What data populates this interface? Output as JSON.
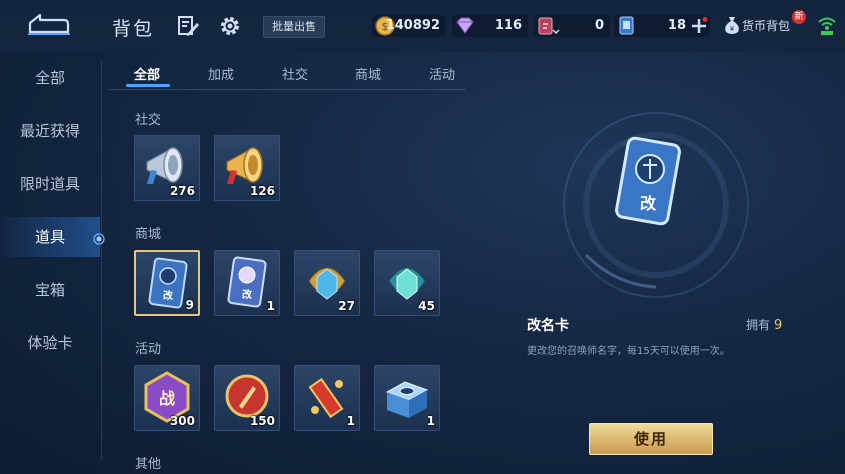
{
  "header": {
    "title": "背包",
    "bulk_sell_label": "批量出售",
    "currency_bag_label": "货币背包",
    "new_badge": "新"
  },
  "resources": [
    {
      "name": "gold-coin",
      "value": "140892"
    },
    {
      "name": "diamond",
      "value": "116"
    },
    {
      "name": "ticket",
      "value": "0"
    },
    {
      "name": "voucher",
      "value": "18"
    }
  ],
  "sidebar": {
    "items": [
      {
        "label": "全部"
      },
      {
        "label": "最近获得"
      },
      {
        "label": "限时道具"
      },
      {
        "label": "道具",
        "active": true
      },
      {
        "label": "宝箱"
      },
      {
        "label": "体验卡"
      }
    ]
  },
  "tabs": [
    {
      "label": "全部",
      "active": true
    },
    {
      "label": "加成"
    },
    {
      "label": "社交"
    },
    {
      "label": "商城"
    },
    {
      "label": "活动"
    }
  ],
  "sections": [
    {
      "label": "社交",
      "items": [
        {
          "icon": "silver-horn-icon",
          "count": "276"
        },
        {
          "icon": "gold-horn-icon",
          "count": "126"
        }
      ]
    },
    {
      "label": "商城",
      "items": [
        {
          "icon": "rename-card-icon",
          "count": "9",
          "selected": true
        },
        {
          "icon": "cat-card-icon",
          "count": "1"
        },
        {
          "icon": "gold-crystal-icon",
          "count": "27"
        },
        {
          "icon": "teal-crystal-icon",
          "count": "45"
        }
      ]
    },
    {
      "label": "活动",
      "items": [
        {
          "icon": "battle-badge-icon",
          "count": "300"
        },
        {
          "icon": "pen-medal-icon",
          "count": "150"
        },
        {
          "icon": "scroll-icon",
          "count": "1"
        },
        {
          "icon": "gift-box-icon",
          "count": "1"
        }
      ]
    },
    {
      "label": "其他",
      "items": []
    }
  ],
  "detail": {
    "name": "改名卡",
    "owned_label": "拥有",
    "owned_count": "9",
    "description": "更改您的召唤师名字，每15天可以使用一次。",
    "card_char": "改",
    "use_label": "使用"
  },
  "colors": {
    "accent_blue": "#4aa4ff",
    "gold": "#e4c87a",
    "button_gold": "#dcb86a",
    "badge_red": "#d6322f"
  }
}
